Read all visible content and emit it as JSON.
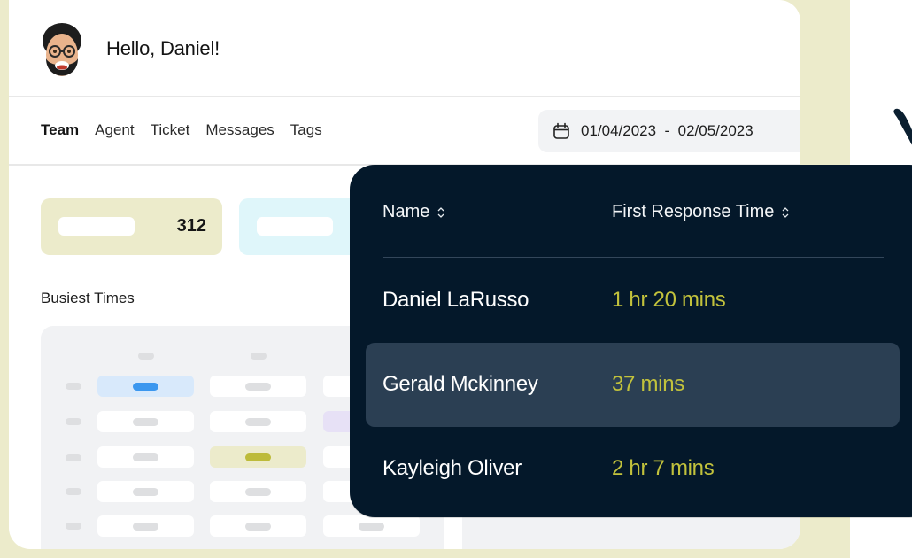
{
  "header": {
    "greeting": "Hello, Daniel!",
    "avatar": "memoji-avatar"
  },
  "tabs": [
    {
      "label": "Team",
      "active": true
    },
    {
      "label": "Agent",
      "active": false
    },
    {
      "label": "Ticket",
      "active": false
    },
    {
      "label": "Messages",
      "active": false
    },
    {
      "label": "Tags",
      "active": false
    }
  ],
  "date_range": {
    "icon": "calendar-icon",
    "label": "01/04/2023  -  02/05/2023"
  },
  "stats": [
    {
      "value": "312",
      "color": "#ecebcb"
    },
    {
      "value": "",
      "color": "#dff6fa"
    }
  ],
  "busiest_times": {
    "title": "Busiest Times",
    "highlights": {
      "blue": "#3b97ef",
      "olive": "#bdbb3a",
      "purple": "#e7e1f6"
    }
  },
  "popover": {
    "columns": [
      {
        "label": "Name",
        "sort_icon": "sort-icon"
      },
      {
        "label": "First Response Time",
        "sort_icon": "sort-icon"
      }
    ],
    "rows": [
      {
        "name": "Daniel LaRusso",
        "time": "1 hr 20 mins",
        "highlighted": false
      },
      {
        "name": "Gerald Mckinney",
        "time": "37 mins",
        "highlighted": true
      },
      {
        "name": "Kayleigh Oliver",
        "time": "2 hr 7 mins",
        "highlighted": false
      }
    ],
    "accent": "#c2c23c",
    "background": "#04182a"
  }
}
